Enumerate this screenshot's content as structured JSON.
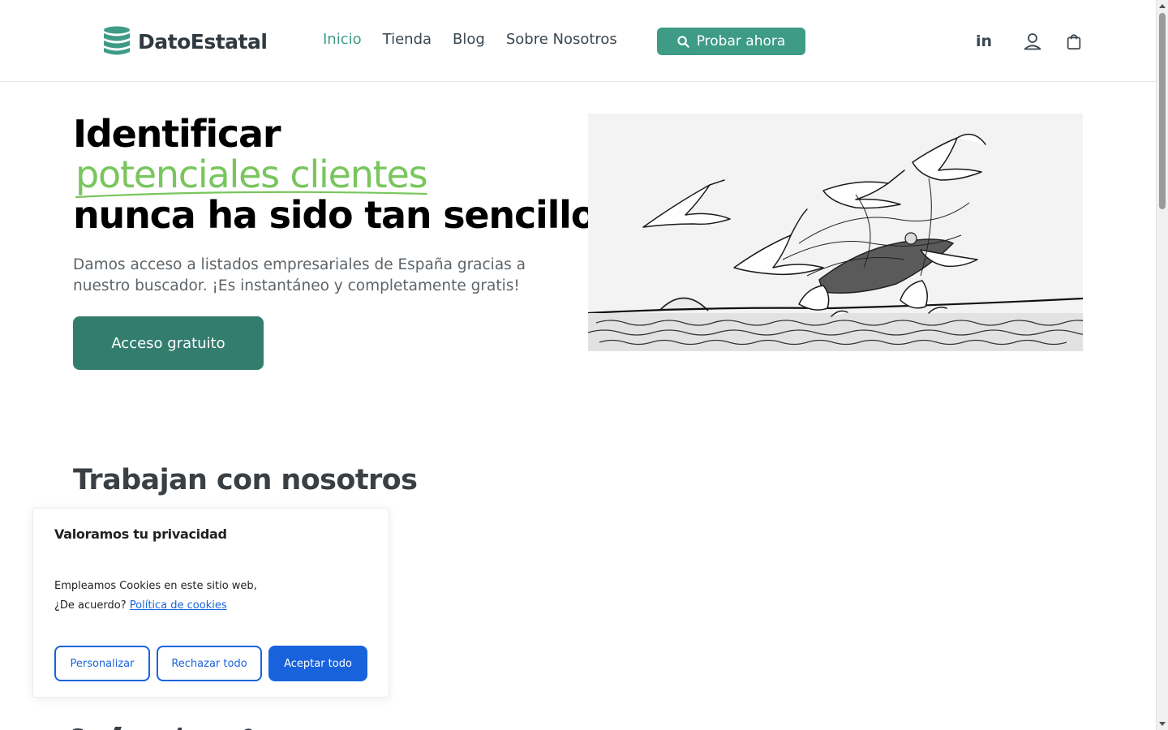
{
  "header": {
    "logo_text": "DatoEstatal",
    "nav": [
      {
        "label": "Inicio",
        "active": true
      },
      {
        "label": "Tienda",
        "active": false
      },
      {
        "label": "Blog",
        "active": false
      },
      {
        "label": "Sobre Nosotros",
        "active": false
      }
    ],
    "cta_label": "Probar ahora",
    "social_label": "in"
  },
  "hero": {
    "title_line1": "Identificar",
    "title_highlight": "potenciales clientes",
    "title_line3": "nunca ha sido tan sencillo",
    "subtitle": "Damos acceso a listados empresariales de España gracias a nuestro buscador. ¡Es instantáneo y completamente gratis!",
    "cta_label": "Acceso gratuito"
  },
  "section": {
    "title": "Trabajan con nosotros"
  },
  "cookie_banner": {
    "title": "Valoramos tu privacidad",
    "text": "Empleamos Cookies en este sitio web, ¿De acuerdo?",
    "link_label": "Política de cookies",
    "buttons": {
      "customize": "Personalizar",
      "reject": "Rechazar todo",
      "accept": "Aceptar todo"
    }
  },
  "colors": {
    "brand": "#3d9b86",
    "brand_dark": "#327d6e",
    "highlight": "#78c65d",
    "cookie_accent": "#1863dc"
  }
}
